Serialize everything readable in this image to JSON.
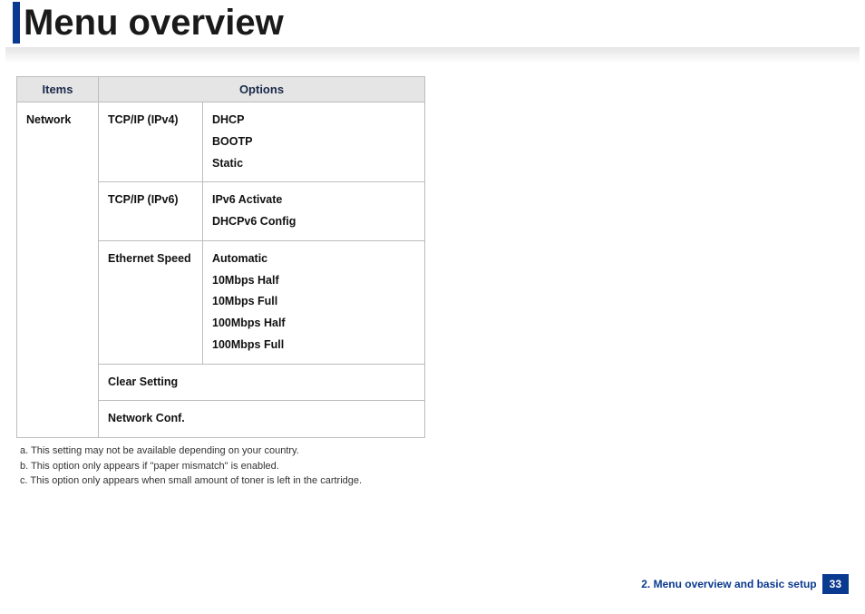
{
  "title": "Menu overview",
  "table": {
    "headers": {
      "items": "Items",
      "options": "Options"
    },
    "group_item": "Network",
    "rows": [
      {
        "subitem": "TCP/IP (IPv4)",
        "options": [
          "DHCP",
          "BOOTP",
          "Static"
        ]
      },
      {
        "subitem": "TCP/IP (IPv6)",
        "options": [
          "IPv6 Activate",
          "DHCPv6 Config"
        ]
      },
      {
        "subitem": "Ethernet Speed",
        "options": [
          "Automatic",
          "10Mbps Half",
          "10Mbps Full",
          "100Mbps Half",
          "100Mbps Full"
        ]
      },
      {
        "subitem": "Clear Setting",
        "options": []
      },
      {
        "subitem": "Network Conf.",
        "options": []
      }
    ]
  },
  "footnotes": [
    "a.  This setting may not be available depending on your country.",
    "b.  This option only appears if \"paper mismatch\" is enabled.",
    "c.  This option only appears when small amount of toner is left in the cartridge."
  ],
  "footer": {
    "section": "2. Menu overview and basic setup",
    "page": "33"
  }
}
